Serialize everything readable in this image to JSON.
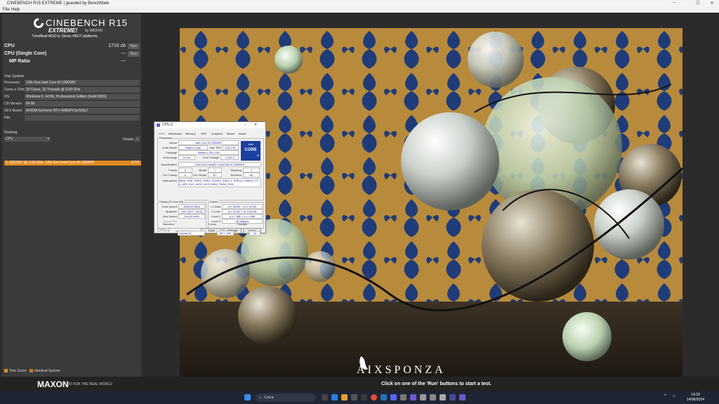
{
  "window": {
    "title": "CINEBENCH R15 EXTREME | guarded by BenchMate",
    "controls": [
      "–",
      "☐",
      "✕"
    ]
  },
  "menu": [
    "File",
    "Help"
  ],
  "logo": {
    "name": "CINEBENCH R15",
    "edition": "EXTREME!",
    "by": "by MAXON",
    "subtitle": "*Unofficial MOD to Stress HEDT platforms."
  },
  "scores": {
    "cpu_label": "CPU",
    "cpu_value": "1710 cb",
    "run_label": "Run",
    "single_label": "CPU (Single Core)",
    "single_value": "---",
    "mp_label": "MP Ratio",
    "mp_value": "---"
  },
  "system": {
    "header": "Your System",
    "rows": [
      {
        "k": "Processor",
        "v": "13th Gen Intel Core i9-13900KF"
      },
      {
        "k": "Cores x GHz",
        "v": "32 Cores, 32 Threads @ 3.00 GHz"
      },
      {
        "k": "OS",
        "v": "Windows 8, 64 Bit, Professional Edition (build 9200)"
      },
      {
        "k": "CB Version",
        "v": "64 Bit"
      },
      {
        "k": "GFX Board",
        "v": "NVIDIA GeForce RTX 4090/PCIe/SSE2"
      },
      {
        "k": "Info",
        "v": ""
      }
    ]
  },
  "ranking": {
    "header": "Ranking",
    "select": "CPU",
    "details": "Details",
    "entry": "1. 32C/32T @ 3.00 GHz, 13th Gen Intel Core i9-13900KF",
    "entry_score": "1710"
  },
  "legend": {
    "your_score": "Your Score",
    "identical": "Identical System",
    "your_color": "#e08a1e",
    "identical_color": "#c8762a"
  },
  "footer": {
    "brand": "MAXON",
    "tagline": "3D FOR THE REAL WORLD",
    "hint": "Click on one of the 'Run' buttons to start a test."
  },
  "render": {
    "watermark": "AIXSPONZA"
  },
  "cpuz": {
    "title": "CPU-Z",
    "tabs": [
      "CPU",
      "Mainboard",
      "Memory",
      "SPD",
      "Graphics",
      "Bench",
      "About"
    ],
    "processor_group": "Processor",
    "name_label": "Name",
    "name": "Intel Core i9 13900KF",
    "codename_label": "Code Name",
    "codename": "Raptor Lake",
    "maxtdp_label": "Max TDP",
    "maxtdp": "125.0 W",
    "package_label": "Package",
    "package": "Socket 1700 LGA",
    "tech_label": "Technology",
    "tech": "10 nm",
    "voltage_label": "Core Voltage",
    "voltage": "1.200 V",
    "spec_label": "Specification",
    "spec": "13th Gen Intel(R) Core(TM) i9-13900KF",
    "family_label": "Family",
    "family": "6",
    "model_label": "Model",
    "model": "7",
    "stepping_label": "Stepping",
    "stepping": "1",
    "extfamily_label": "Ext. Family",
    "extfamily": "6",
    "extmodel_label": "Ext. Model",
    "extmodel": "B7",
    "revision_label": "Revision",
    "revision": "B0",
    "instr_label": "Instructions",
    "instr": "MMX, SSE, SSE2, SSE3, SSSE3, SSE4.1, SSE4.2, EM64T, VT-x, AES, AVX, AVX2, AVX-VNNI, FMA3, SHA",
    "clocks_group": "Clocks (P-Core #0)",
    "corespeed_label": "Core Speed",
    "corespeed": "3000.00 MHz",
    "multiplier_label": "Multiplier",
    "multiplier": "x30.0 (8.0 - 55.0)",
    "bus_label": "Bus Speed",
    "bus": "100.00 MHz",
    "ratedfsb_label": "Rated FSB",
    "cache_group": "Cache",
    "l1d_label": "L1 Data",
    "l1d": "8 x 48 kB + 16 x 32 kB",
    "l1i_label": "L1 Inst.",
    "l1i": "8 x 32 kB + 16 x 64 kB",
    "l2_label": "Level 2",
    "l2": "8 x 2 MB + 4 x 4 MB",
    "l3_label": "Level 3",
    "l3": "36 MBytes",
    "selection_label": "Selection",
    "selection": "Socket #1",
    "cores_label": "Cores",
    "cores": "8P + 16E",
    "threads_label": "Threads",
    "threads": "32",
    "version": "Ver. 2.10.0.x64",
    "tools": "Tools",
    "validate": "Validate",
    "close": "Close",
    "intel_brand": "intel",
    "intel_core": "CORE",
    "intel_i": "i9"
  },
  "taskbar": {
    "search": "Cerca",
    "time": "14:29",
    "date": "14/06/2024"
  }
}
